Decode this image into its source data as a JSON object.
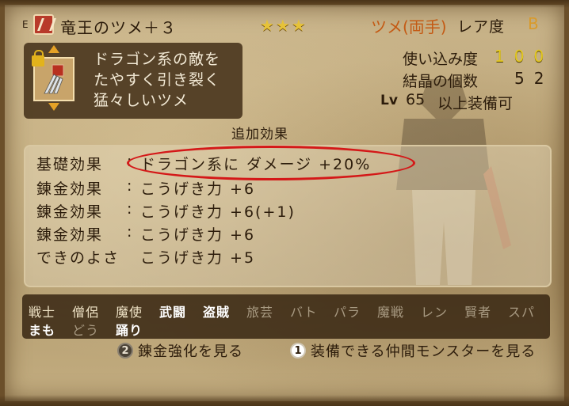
{
  "header": {
    "badge": "E",
    "item_name": "竜王のツメ＋３",
    "stars": "★★★",
    "weapon_type": "ツメ(両手)",
    "rarity_label": "レア度",
    "rarity_value": "B"
  },
  "description": {
    "lines": [
      "ドラゴン系の敵を",
      "たやすく引き裂く",
      "猛々しいツメ"
    ]
  },
  "stats": {
    "durability_label": "使い込み度",
    "durability_value": "100",
    "crystal_label": "結晶の個数",
    "crystal_value": "52",
    "level_prefix": "Lv",
    "level_value": "65",
    "level_suffix": "以上装備可"
  },
  "effects": {
    "title": "追加効果",
    "rows": [
      {
        "label": "基礎効果",
        "value": "ドラゴン系に ダメージ +20%"
      },
      {
        "label": "錬金効果",
        "value": "こうげき力 +6"
      },
      {
        "label": "錬金効果",
        "value": "こうげき力 +6(+1)"
      },
      {
        "label": "錬金効果",
        "value": "こうげき力 +6"
      },
      {
        "label": "できのよさ",
        "value": "こうげき力 +5"
      }
    ]
  },
  "jobs": {
    "row1": [
      "戦士",
      "僧侶",
      "魔使",
      "武闘",
      "盗賊",
      "旅芸",
      "バト",
      "パラ",
      "魔戦",
      "レン",
      "賢者",
      "スパ"
    ],
    "row2": [
      "まも",
      "どう",
      "踊り"
    ]
  },
  "buttons": {
    "alchemy": {
      "number": "2",
      "label": "錬金強化を見る"
    },
    "monsters": {
      "number": "1",
      "label": "装備できる仲間モンスターを見る"
    }
  },
  "colors": {
    "highlight_oval": "#d41818",
    "stars": "#e6c238",
    "weapon_type": "#c45a14",
    "stat_numbers": "#e3c81e"
  }
}
